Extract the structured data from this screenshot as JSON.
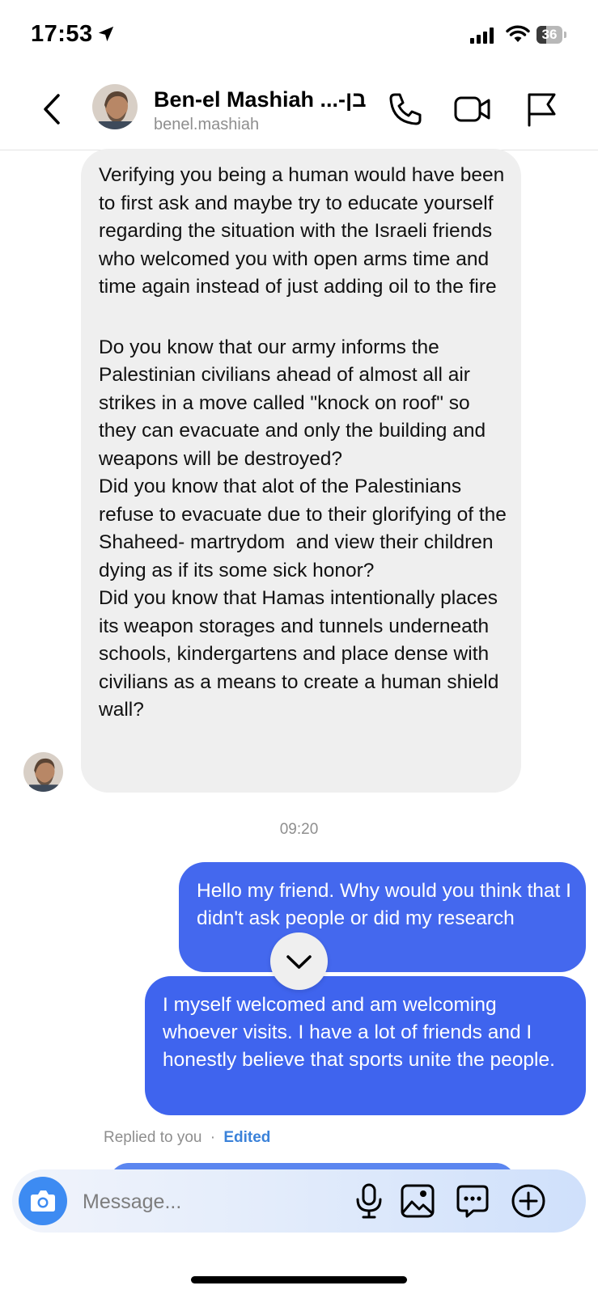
{
  "status_bar": {
    "time": "17:53",
    "battery": "36",
    "battery_percent": 36,
    "icons": [
      "location-arrow-icon",
      "cellular-signal-icon",
      "wifi-icon",
      "battery-icon"
    ]
  },
  "header": {
    "contact_name": "Ben-el Mashiah ...-בן",
    "username": "benel.mashiah",
    "icons": [
      "back-icon",
      "phone-icon",
      "video-icon",
      "flag-icon"
    ]
  },
  "messages": {
    "incoming": {
      "paragraphs": [
        "Verifying you being a human would have been to first ask and maybe try to educate yourself regarding the situation with the Israeli friends who welcomed you with open arms time and time again instead of just adding oil to the fire",
        "Do you know that our army informs the Palestinian civilians ahead of almost all air strikes in a move called \"knock on roof\" so they can evacuate and only the building and weapons will be destroyed?",
        "Did you know that alot of the Palestinians refuse to evacuate due to their glorifying of the Shaheed- martrydom  and view their children dying as if its some sick honor?",
        "Did you know that Hamas intentionally places its weapon storages and tunnels underneath schools, kindergartens and place dense with civilians as a means to create a human shield wall?"
      ]
    },
    "timestamp": "09:20",
    "outgoing": [
      "Hello my friend. Why would you think that I didn't ask people or did my research",
      "I myself welcomed and am welcoming whoever visits. I have a lot of friends and I honestly believe that sports unite the people."
    ],
    "replied_label": "Replied to you",
    "separator": "·",
    "edited_label": "Edited"
  },
  "composer": {
    "placeholder": "Message...",
    "icons": [
      "camera-icon",
      "microphone-icon",
      "gallery-icon",
      "sticker-icon",
      "add-icon"
    ]
  },
  "colors": {
    "outgoing_bubble": "#4468ee",
    "incoming_bubble": "#efefef",
    "camera_button": "#3d8bf2",
    "edited_link": "#3b82d9"
  }
}
